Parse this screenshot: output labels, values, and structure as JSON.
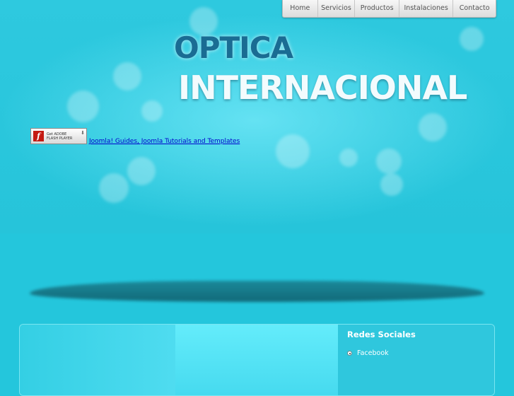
{
  "nav": {
    "items": [
      "Home",
      "Servicios",
      "Productos",
      "Instalaciones",
      "Contacto"
    ]
  },
  "header": {
    "logo_line1": "OPTICA",
    "logo_line2": "INTERNACIONAL"
  },
  "flash_badge": {
    "logo_glyph": "f",
    "text_line1": "Get ADOBE",
    "text_line2": "FLASH PLAYER",
    "icon": "download-arrow-icon"
  },
  "promo_link": "Joomla! Guides, Joomla Tutorials and Templates",
  "sidebar": {
    "title": "Redes Sociales",
    "items": [
      {
        "label": "Facebook"
      }
    ]
  },
  "colors": {
    "background": "#24c6dc",
    "logo_dark": "#1a6c93",
    "logo_light": "#f3fbfd",
    "link": "#0000cc"
  }
}
